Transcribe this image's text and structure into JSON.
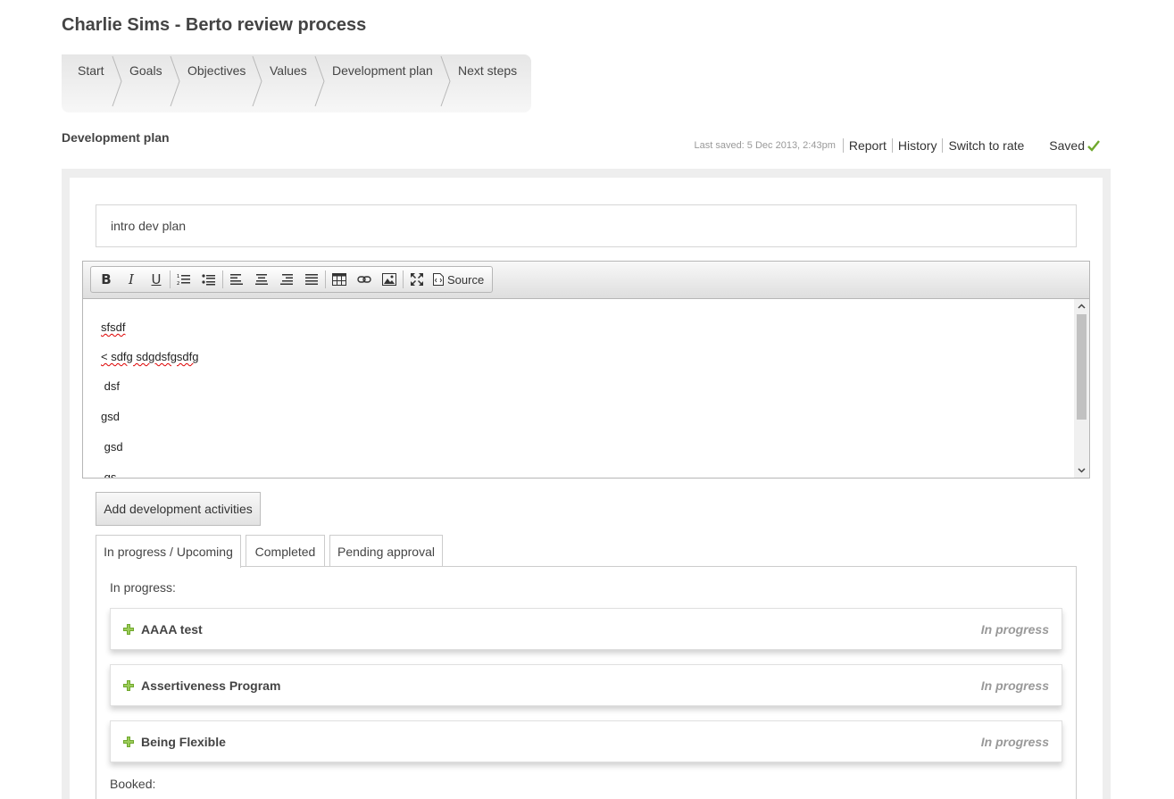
{
  "page": {
    "title": "Charlie Sims - Berto review process"
  },
  "steps": [
    "Start",
    "Goals",
    "Objectives",
    "Values",
    "Development plan",
    "Next steps"
  ],
  "section": {
    "title": "Development plan"
  },
  "meta": {
    "last_saved": "Last saved: 5 Dec 2013, 2:43pm",
    "links": [
      "Report",
      "History",
      "Switch to rate"
    ],
    "saved_label": "Saved"
  },
  "intro": {
    "text": "intro dev plan"
  },
  "editor": {
    "toolbar": {
      "buttons": [
        "bold-icon",
        "italic-icon",
        "underline-icon",
        "numbered-list-icon",
        "bulleted-list-icon",
        "align-left-icon",
        "align-center-icon",
        "align-right-icon",
        "justify-icon",
        "table-icon",
        "link-icon",
        "image-icon",
        "maximize-icon"
      ],
      "source_label": "Source"
    },
    "lines": [
      "sfsdf",
      "< sdfg sdgdsfgsdfg",
      " dsf",
      "gsd",
      " gsd",
      " gs"
    ]
  },
  "add_button": {
    "label": "Add development activities"
  },
  "tabs": [
    "In progress / Upcoming",
    "Completed",
    "Pending approval"
  ],
  "groups": {
    "in_progress": "In progress:",
    "booked": "Booked:"
  },
  "activities": [
    {
      "title": "AAAA test",
      "status": "In progress"
    },
    {
      "title": "Assertiveness Program",
      "status": "In progress"
    },
    {
      "title": "Being Flexible",
      "status": "In progress"
    }
  ],
  "colors": {
    "accent_green": "#6fa82c",
    "status_grey": "#999999"
  }
}
